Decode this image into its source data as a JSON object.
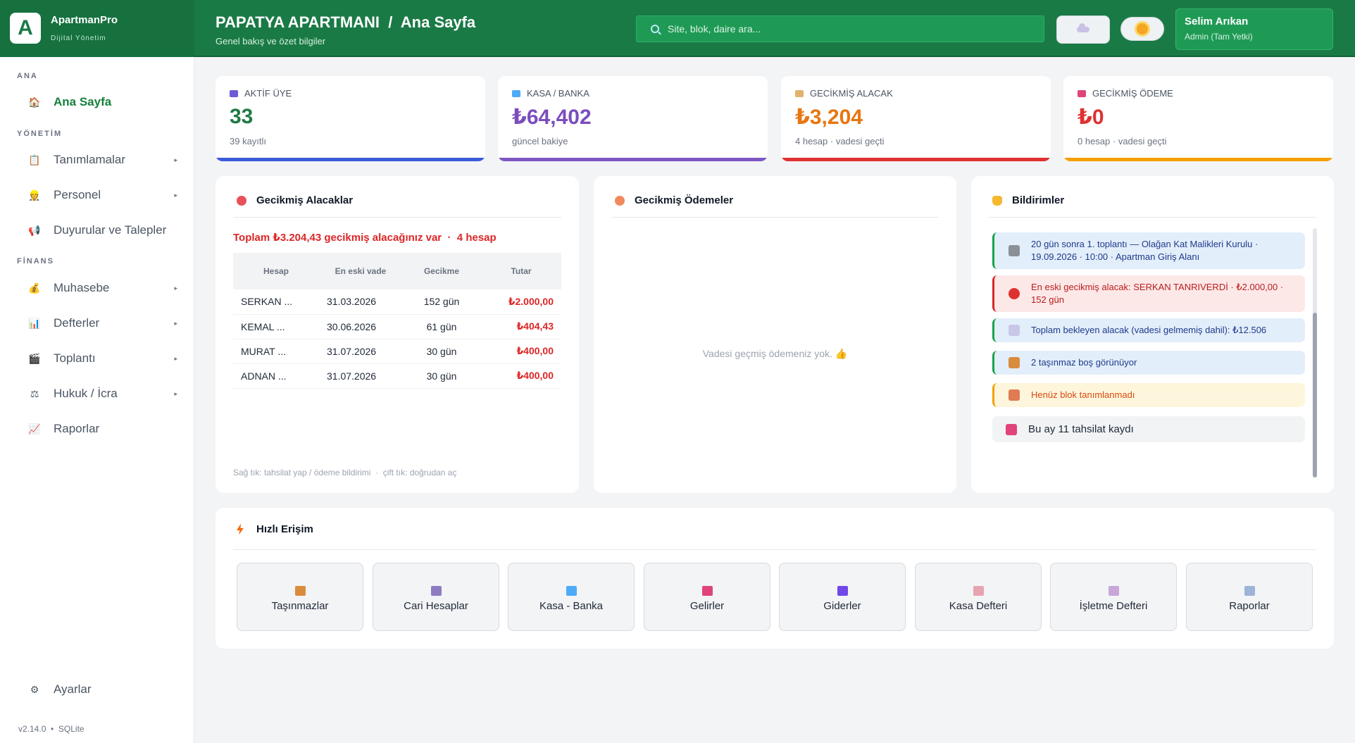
{
  "brand": {
    "logo_letter": "A",
    "name": "ApartmanPro",
    "subtitle": "Dijital Yönetim"
  },
  "header": {
    "title": "PAPATYA APARTMANI  /  Ana Sayfa",
    "subtitle": "Genel bakış ve özet bilgiler",
    "search_placeholder": "Site, blok, daire ara...",
    "user_name": "Selim Arıkan",
    "user_role": "Admin (Tam Yetki)"
  },
  "sidebar": {
    "sections": {
      "ana": "ANA",
      "yonetim": "YÖNETİM",
      "finans": "FİNANS"
    },
    "items": [
      {
        "label": "Ana Sayfa",
        "icon": "house-icon"
      },
      {
        "label": "Tanımlamalar",
        "icon": "clipboard-icon"
      },
      {
        "label": "Personel",
        "icon": "person-icon"
      },
      {
        "label": "Duyurular ve Talepler",
        "icon": "megaphone-icon"
      },
      {
        "label": "Muhasebe",
        "icon": "money-bag-icon"
      },
      {
        "label": "Defterler",
        "icon": "bar-chart-icon"
      },
      {
        "label": "Toplantı",
        "icon": "clapper-icon"
      },
      {
        "label": "Hukuk / İcra",
        "icon": "scales-icon"
      },
      {
        "label": "Raporlar",
        "icon": "trend-chart-icon"
      },
      {
        "label": "Ayarlar",
        "icon": "gear-icon"
      }
    ],
    "caret": "▸",
    "version": "v2.14.0  •  SQLite"
  },
  "stats": [
    {
      "label": "AKTİF ÜYE",
      "value": "33",
      "sub": "39 kayıtlı",
      "color": "#1f7a45",
      "bar": "#3b5bdb",
      "icon": "people-icon"
    },
    {
      "label": "KASA / BANKA",
      "value": "₺64,402",
      "sub": "güncel bakiye",
      "color": "#7c4dbe",
      "bar": "#7e57c2",
      "icon": "card-icon"
    },
    {
      "label": "GECİKMİŞ ALACAK",
      "value": "₺3,204",
      "sub": "4 hesap · vadesi geçti",
      "color": "#e8760f",
      "bar": "#e03131",
      "icon": "hourglass-icon"
    },
    {
      "label": "GECİKMİŞ ÖDEME",
      "value": "₺0",
      "sub": "0 hesap · vadesi geçti",
      "color": "#e03131",
      "bar": "#f59f00",
      "icon": "outbox-icon"
    }
  ],
  "overdue_receivables": {
    "title": "Gecikmiş Alacaklar",
    "summary": "Toplam ₺3.204,43 gecikmiş alacağınız var  ·  4 hesap",
    "columns": [
      "Hesap",
      "En eski vade",
      "Gecikme",
      "Tutar"
    ],
    "rows": [
      [
        "SERKAN ...",
        "31.03.2026",
        "152 gün",
        "₺2.000,00"
      ],
      [
        "KEMAL ...",
        "30.06.2026",
        "61 gün",
        "₺404,43"
      ],
      [
        "MURAT ...",
        "31.07.2026",
        "30 gün",
        "₺400,00"
      ],
      [
        "ADNAN ...",
        "31.07.2026",
        "30 gün",
        "₺400,00"
      ]
    ],
    "hint": "Sağ tık: tahsilat yap / ödeme bildirimi  ·  çift tık: doğrudan aç"
  },
  "overdue_payments": {
    "title": "Gecikmiş Ödemeler",
    "empty": "Vadesi geçmiş ödemeniz yok. 👍"
  },
  "notifications": {
    "title": "Bildirimler",
    "items": [
      {
        "text": "20 gün sonra 1. toplantı — Olağan Kat Malikleri Kurulu · 19.09.2026 · 10:00 · Apartman Giriş Alanı",
        "icon": "clapper-icon"
      },
      {
        "text": "En eski gecikmiş alacak: SERKAN TANRIVERDİ · ₺2.000,00 · 152 gün",
        "icon": "red-circle-icon"
      },
      {
        "text": "Toplam bekleyen alacak (vadesi gelmemiş dahil): ₺12.506",
        "icon": "document-icon"
      },
      {
        "text": "2 taşınmaz boş görünüyor",
        "icon": "house-icon"
      },
      {
        "text": "Henüz blok tanımlanmadı",
        "icon": "houses-icon"
      },
      {
        "text": "Bu ay 11 tahsilat kaydı",
        "icon": "inbox-icon"
      }
    ]
  },
  "quick_access": {
    "title": "Hızlı Erişim",
    "items": [
      {
        "label": "Taşınmazlar",
        "icon": "house-icon"
      },
      {
        "label": "Cari Hesaplar",
        "icon": "calendar-icon"
      },
      {
        "label": "Kasa - Banka",
        "icon": "card-icon"
      },
      {
        "label": "Gelirler",
        "icon": "inbox-icon"
      },
      {
        "label": "Giderler",
        "icon": "outbox-icon"
      },
      {
        "label": "Kasa Defteri",
        "icon": "clipboard-icon"
      },
      {
        "label": "İşletme Defteri",
        "icon": "notepad-icon"
      },
      {
        "label": "Raporlar",
        "icon": "trend-chart-icon"
      }
    ]
  }
}
